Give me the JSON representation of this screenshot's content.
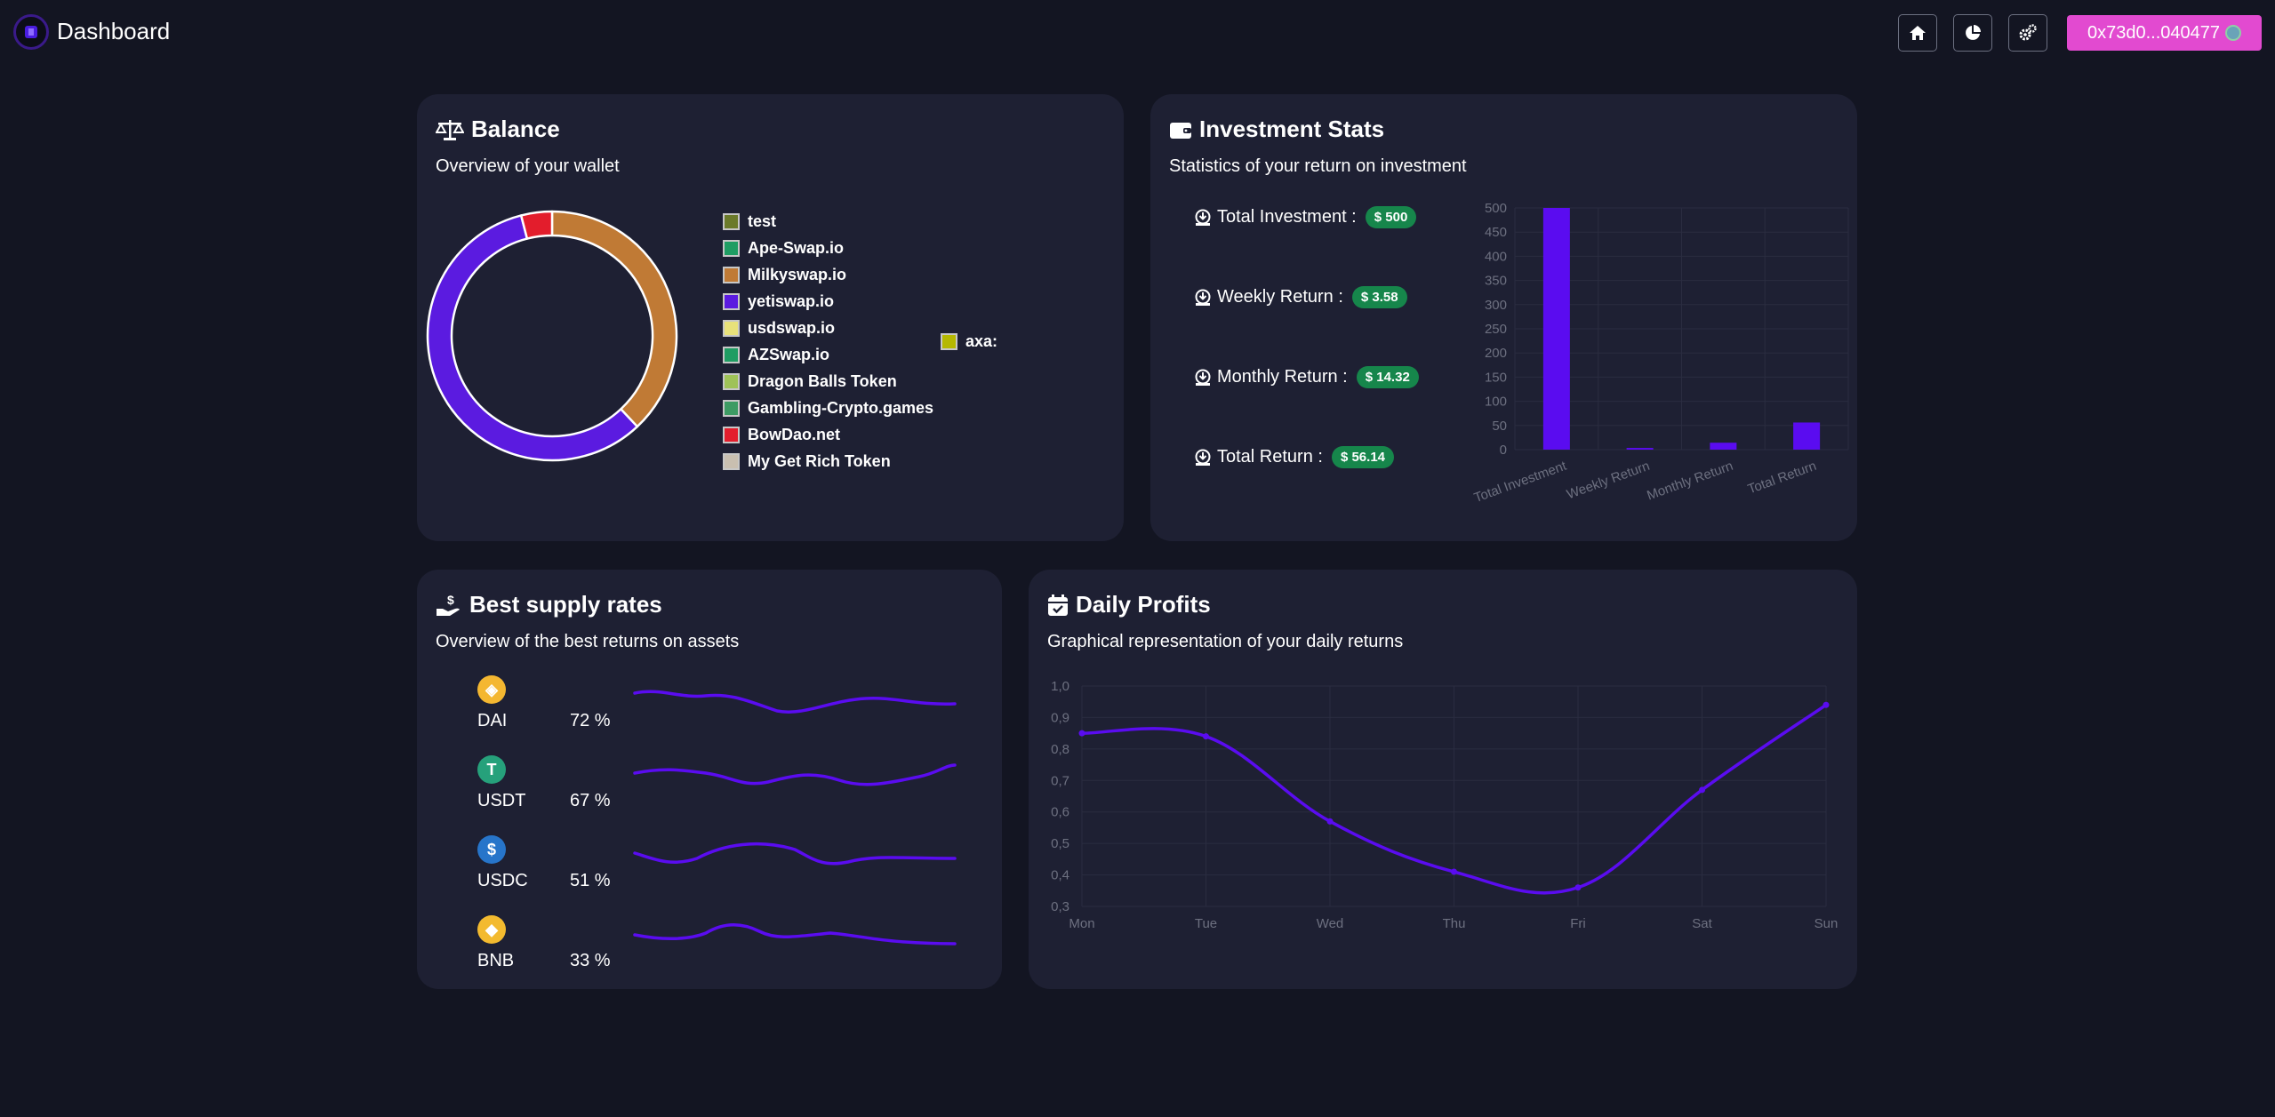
{
  "header": {
    "title": "Dashboard",
    "wallet_address": "0x73d0...040477",
    "nav_icons": [
      "home-icon",
      "pie-chart-icon",
      "settings-icon"
    ]
  },
  "balance": {
    "title": "Balance",
    "subtitle": "Overview of your wallet",
    "chart_data": {
      "type": "pie",
      "variant": "doughnut",
      "legend_position": "right",
      "labels": [
        "test",
        "Ape-Swap.io",
        "Milkyswap.io",
        "yetiswap.io",
        "usdswap.io",
        "AZSwap.io",
        "Dragon Balls Token",
        "Gambling-Crypto.games",
        "BowDao.net",
        "My Get Rich Token",
        "axa"
      ],
      "legend_label_overflow": "axa:",
      "colors": [
        "#6b7a2a",
        "#1f9d63",
        "#c07a35",
        "#5b1be0",
        "#e8e17a",
        "#1f9d63",
        "#9fc257",
        "#3d9b63",
        "#e31d2c",
        "#c9bfb0",
        "#b5b800"
      ],
      "values": [
        0,
        0,
        38,
        58,
        0,
        0,
        0,
        0,
        4,
        0,
        0
      ]
    }
  },
  "investment": {
    "title": "Investment Stats",
    "subtitle": "Statistics of your return on investment",
    "stats": [
      {
        "label": "Total Investment :",
        "value": "$ 500"
      },
      {
        "label": "Weekly Return :",
        "value": "$ 3.58"
      },
      {
        "label": "Monthly Return :",
        "value": "$ 14.32"
      },
      {
        "label": "Total Return :",
        "value": "$ 56.14"
      }
    ],
    "chart_data": {
      "type": "bar",
      "categories": [
        "Total Investment",
        "Weekly Return",
        "Monthly Return",
        "Total Return"
      ],
      "values": [
        500,
        3.58,
        14.32,
        56.14
      ],
      "ylim": [
        0,
        500
      ],
      "yticks": [
        "0",
        "50",
        "100",
        "150",
        "200",
        "250",
        "300",
        "350",
        "400",
        "450",
        "500"
      ],
      "color": "#5a0cf0",
      "grid": true
    }
  },
  "supply": {
    "title": "Best supply rates",
    "subtitle": "Overview of the best returns on assets",
    "assets": [
      {
        "name": "DAI",
        "rate": "72 %",
        "color": "#f4b731",
        "icon": "dai-coin-icon"
      },
      {
        "name": "USDT",
        "rate": "67 %",
        "color": "#26a17b",
        "icon": "usdt-coin-icon"
      },
      {
        "name": "USDC",
        "rate": "51 %",
        "color": "#2775ca",
        "icon": "usdc-coin-icon"
      },
      {
        "name": "BNB",
        "rate": "33 %",
        "color": "#f3ba2f",
        "icon": "bnb-coin-icon"
      }
    ]
  },
  "daily": {
    "title": "Daily Profits",
    "subtitle": "Graphical representation of your daily returns",
    "chart_data": {
      "type": "line",
      "x": [
        "Mon",
        "Tue",
        "Wed",
        "Thu",
        "Fri",
        "Sat",
        "Sun"
      ],
      "values": [
        0.85,
        0.84,
        0.57,
        0.41,
        0.36,
        0.67,
        0.94
      ],
      "ylim": [
        0.3,
        1.0
      ],
      "yticks": [
        "0,3",
        "0,4",
        "0,5",
        "0,6",
        "0,7",
        "0,8",
        "0,9",
        "1,0"
      ],
      "color": "#5a0cf0",
      "grid": true
    }
  }
}
